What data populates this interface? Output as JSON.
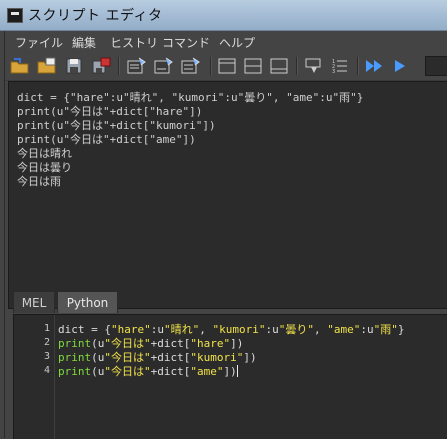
{
  "window": {
    "title": "スクリプト エディタ"
  },
  "menu": [
    "ファイル",
    "編集",
    "ヒストリ",
    "コマンド",
    "ヘルプ"
  ],
  "toolbar": {
    "buttons": [
      "open-script-icon",
      "source-script-icon",
      "save-script-icon",
      "save-to-shelf-icon",
      "clear-history-icon",
      "clear-input-icon",
      "clear-all-icon",
      "show-history-icon",
      "show-both-icon",
      "show-input-icon",
      "echo-all-commands-icon",
      "line-numbers-icon",
      "execute-all-icon",
      "execute-selected-icon"
    ]
  },
  "output": {
    "lines": [
      "dict = {\"hare\":u\"晴れ\", \"kumori\":u\"曇り\", \"ame\":u\"雨\"}",
      "print(u\"今日は\"+dict[\"hare\"])",
      "print(u\"今日は\"+dict[\"kumori\"])",
      "print(u\"今日は\"+dict[\"ame\"])",
      "今日は晴れ",
      "今日は曇り",
      "今日は雨"
    ]
  },
  "tabs": [
    {
      "label": "MEL",
      "active": false
    },
    {
      "label": "Python",
      "active": true
    }
  ],
  "editor": {
    "line_numbers": [
      "1",
      "2",
      "3",
      "4"
    ],
    "l1": {
      "a": "dict = {",
      "b": "\"hare\"",
      "c": ":u",
      "d": "\"晴れ\"",
      "e": ", ",
      "f": "\"kumori\"",
      "g": ":u",
      "h": "\"曇り\"",
      "i": ", ",
      "j": "\"ame\"",
      "k": ":u",
      "l": "\"雨\"",
      "m": "}"
    },
    "l2": {
      "kw": "print",
      "a": "(u",
      "b": "\"今日は\"",
      "c": "+dict[",
      "d": "\"hare\"",
      "e": "])"
    },
    "l3": {
      "kw": "print",
      "a": "(u",
      "b": "\"今日は\"",
      "c": "+dict[",
      "d": "\"kumori\"",
      "e": "])"
    },
    "l4": {
      "kw": "print",
      "a": "(u",
      "b": "\"今日は\"",
      "c": "+dict[",
      "d": "\"ame\"",
      "e": "])"
    }
  }
}
